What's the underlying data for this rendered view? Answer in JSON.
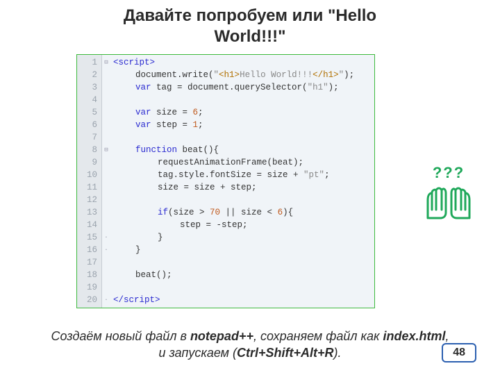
{
  "title_line1": "Давайте попробуем или \"Hello",
  "title_line2": "World!!!\"",
  "code": {
    "gutter": [
      "1",
      "2",
      "3",
      "4",
      "5",
      "6",
      "7",
      "8",
      "9",
      "10",
      "11",
      "12",
      "13",
      "14",
      "15",
      "16",
      "17",
      "18",
      "19",
      "20"
    ],
    "fold": [
      "⊟",
      "",
      "",
      "",
      "",
      "",
      "",
      "⊟",
      "",
      "",
      "",
      "",
      "",
      "",
      "·",
      "·",
      "",
      "",
      "",
      "·"
    ],
    "lines": [
      {
        "indent": 0,
        "html": "&lt;script&gt;",
        "cls": "kw"
      },
      {
        "indent": 1,
        "html": "document.write(<span class='str'>\"</span><span class='marker'>&lt;h1&gt;</span><span class='str'>Hello World!!!</span><span class='marker'>&lt;/h1&gt;</span><span class='str'>\"</span>);"
      },
      {
        "indent": 1,
        "html": "<span class='kw'>var</span> tag = document.querySelector(<span class='str'>\"h1\"</span>);"
      },
      {
        "indent": 0,
        "html": ""
      },
      {
        "indent": 1,
        "html": "<span class='kw'>var</span> size = <span class='nm'>6</span>;"
      },
      {
        "indent": 1,
        "html": "<span class='kw'>var</span> step = <span class='nm'>1</span>;"
      },
      {
        "indent": 0,
        "html": ""
      },
      {
        "indent": 1,
        "html": "<span class='kw'>function</span> beat(){"
      },
      {
        "indent": 2,
        "html": "requestAnimationFrame(beat);"
      },
      {
        "indent": 2,
        "html": "tag.style.fontSize = size + <span class='str'>\"pt\"</span>;"
      },
      {
        "indent": 2,
        "html": "size = size + step;"
      },
      {
        "indent": 0,
        "html": ""
      },
      {
        "indent": 2,
        "html": "<span class='kw'>if</span>(size &gt; <span class='nm'>70</span> || size &lt; <span class='nm'>6</span>){"
      },
      {
        "indent": 3,
        "html": "step = -step;"
      },
      {
        "indent": 2,
        "html": "}"
      },
      {
        "indent": 1,
        "html": "}"
      },
      {
        "indent": 0,
        "html": ""
      },
      {
        "indent": 1,
        "html": "beat();"
      },
      {
        "indent": 0,
        "html": ""
      },
      {
        "indent": 0,
        "html": "&lt;/script&gt;",
        "cls": "kw"
      }
    ]
  },
  "caption_parts": {
    "p1": "Создаём новый файл в ",
    "b1": "notepad++",
    "p2": ", сохраняем файл как ",
    "b2": "index.html",
    "p3": ", и запускаем (",
    "b3": "Ctrl+Shift+Alt+R",
    "p4": ")."
  },
  "hands_label": "???",
  "page_number": "48"
}
